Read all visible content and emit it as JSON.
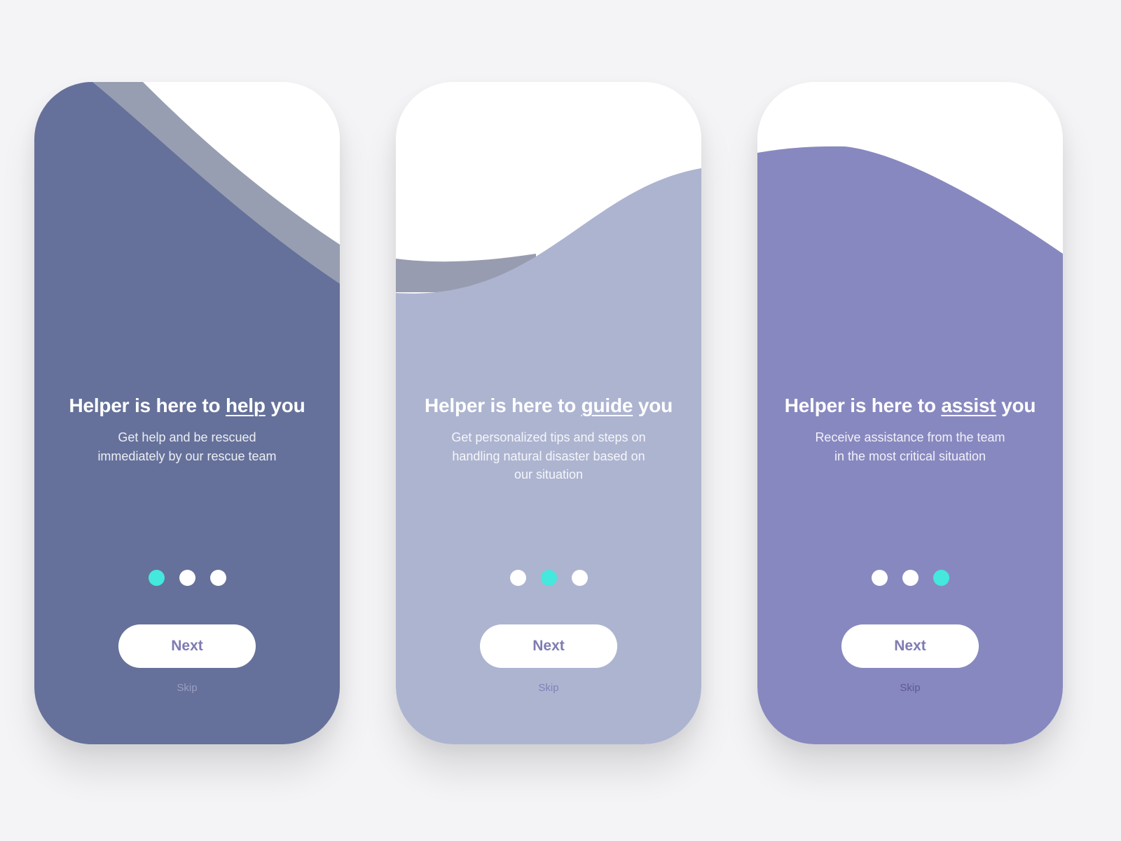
{
  "colors": {
    "page_background": "#f4f4f6",
    "accent_dot": "#44e8dc",
    "button_text": "#7f7bb3"
  },
  "screens": [
    {
      "background_color": "#65719a",
      "shadow_band_color": "#989eb1",
      "title_prefix": "Helper is here to ",
      "title_keyword": "help",
      "title_suffix": " you",
      "subtitle_line1": "Get help and be rescued",
      "subtitle_line2": "immediately by our rescue team",
      "subtitle_line3": "",
      "active_step": 1,
      "total_steps": 3,
      "next_label": "Next",
      "skip_label": "Skip"
    },
    {
      "background_color": "#adb4d0",
      "shadow_band_color": "#989cb0",
      "title_prefix": "Helper is here to ",
      "title_keyword": "guide",
      "title_suffix": " you",
      "subtitle_line1": "Get personalized tips and steps on",
      "subtitle_line2": "handling natural disaster based on",
      "subtitle_line3": "our situation",
      "active_step": 2,
      "total_steps": 3,
      "next_label": "Next",
      "skip_label": "Skip"
    },
    {
      "background_color": "#8888c0",
      "shadow_band_color": "",
      "title_prefix": "Helper is here to ",
      "title_keyword": "assist",
      "title_suffix": " you",
      "subtitle_line1": "Receive assistance from the team",
      "subtitle_line2": "in the most critical situation",
      "subtitle_line3": "",
      "active_step": 3,
      "total_steps": 3,
      "next_label": "Next",
      "skip_label": "Skip"
    }
  ]
}
